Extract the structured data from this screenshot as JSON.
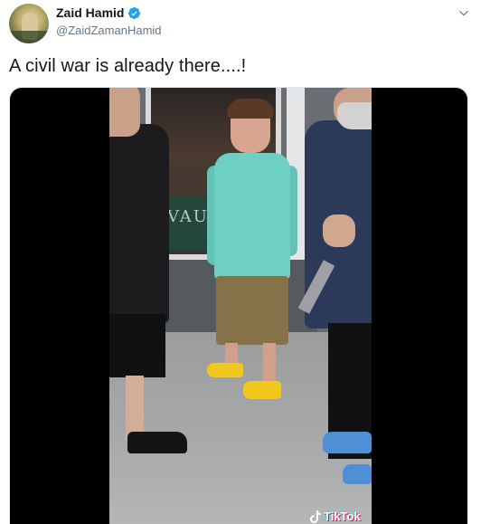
{
  "author": {
    "display_name": "Zaid Hamid",
    "handle": "@ZaidZamanHamid",
    "verified_icon": "verified-badge-icon",
    "avatar_icon": "profile-avatar"
  },
  "tweet": {
    "text": "A civil war is already there....!"
  },
  "menu": {
    "icon": "chevron-down-icon"
  },
  "media": {
    "sign_text": "VAU",
    "watermark_label": "TikTok",
    "watermark_icon": "tiktok-note-icon"
  },
  "colors": {
    "verified": "#1da1f2",
    "handle": "#657786",
    "text": "#14171a",
    "media_bg": "#000000"
  }
}
